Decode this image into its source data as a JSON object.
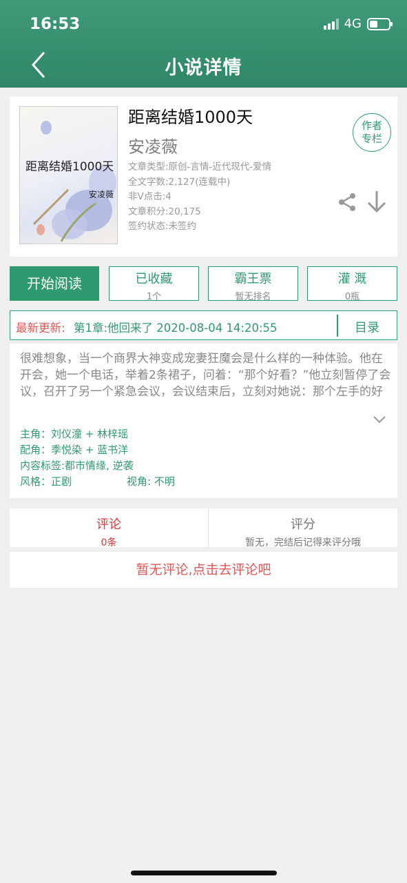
{
  "status": {
    "time": "16:53",
    "network": "4G"
  },
  "header": {
    "title": "小说详情"
  },
  "book": {
    "title": "距离结婚1000天",
    "author": "安凌薇",
    "cover_title": "距离结婚1000天",
    "cover_author": "安凌薇",
    "meta": [
      "文章类型:原创-言情-近代现代-爱情",
      "全文字数:2,127(连载中)",
      "非V点击:4",
      "文章积分:20,175",
      "签约状态:未签约"
    ],
    "author_column_line1": "作者",
    "author_column_line2": "专栏"
  },
  "actions": {
    "start_reading": "开始阅读",
    "collect_label": "已收藏",
    "collect_count": "1个",
    "vote_label": "霸王票",
    "vote_rank": "暂无排名",
    "water_label": "灌 溉",
    "water_count": "0瓶"
  },
  "update": {
    "label": "最新更新:",
    "text": "第1章:他回来了 2020-08-04 14:20:55",
    "toc": "目录"
  },
  "intro": {
    "summary": "很难想象，当一个商界大神变成宠妻狂魔会是什么样的一种体验。他在开会，她一个电话，举着2条裙子，问着：“那个好看？”他立刻暂停了会议，召开了另一个紧急会议，会议结束后，立刻对她说：那个左手的好看！当她身犯险境…",
    "protagonists": "主角：刘仪潼 + 林梓瑶",
    "supporting": "配角：季悦染 + 蓝书洋",
    "tags": "内容标签:都市情缘, 逆袭",
    "style": "风格：正剧",
    "perspective": "视角: 不明"
  },
  "tabs": {
    "comments_label": "评论",
    "comments_count": "0条",
    "rating_label": "评分",
    "rating_note": "暂无，完结后记得来评分哦"
  },
  "no_comments": "暂无评论,点击去评论吧",
  "colors": {
    "brand_green": "#2f9a6f",
    "accent_red": "#e05757"
  }
}
